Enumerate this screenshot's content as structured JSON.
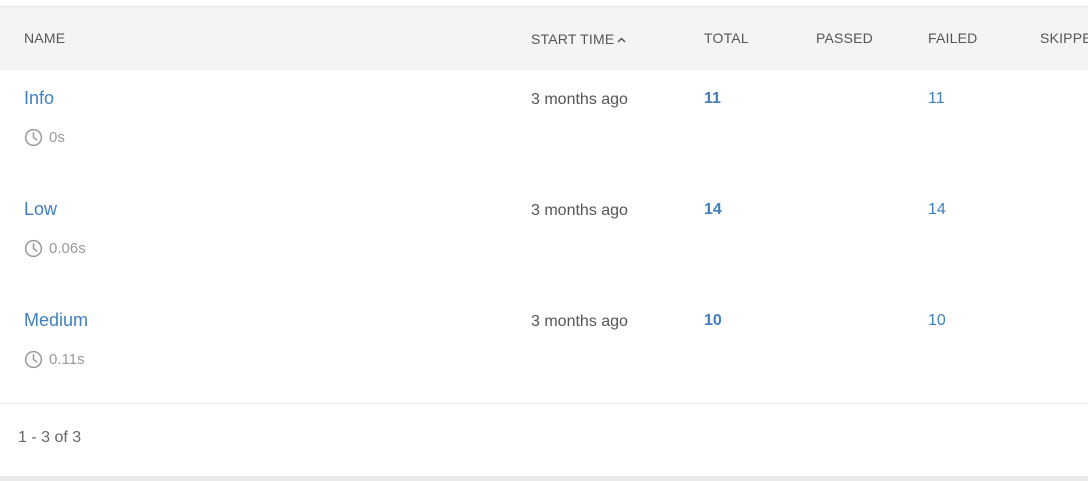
{
  "table": {
    "columns": {
      "name": "NAME",
      "start_time": "START TIME",
      "total": "TOTAL",
      "passed": "PASSED",
      "failed": "FAILED",
      "skipped": "SKIPPED"
    },
    "sort": {
      "column": "start_time",
      "direction": "ascending",
      "icon": "chevron-up-icon"
    },
    "rows": [
      {
        "name": "Info",
        "duration": "0s",
        "start_time": "3 months ago",
        "total": "11",
        "passed": "",
        "failed": "11",
        "duration_icon": "clock-icon"
      },
      {
        "name": "Low",
        "duration": "0.06s",
        "start_time": "3 months ago",
        "total": "14",
        "passed": "",
        "failed": "14",
        "duration_icon": "clock-icon"
      },
      {
        "name": "Medium",
        "duration": "0.11s",
        "start_time": "3 months ago",
        "total": "10",
        "passed": "",
        "failed": "10",
        "duration_icon": "clock-icon"
      }
    ]
  },
  "pagination": {
    "label": "1 - 3 of 3"
  },
  "colors": {
    "link": "#3f7fbf",
    "header_bg": "#f4f4f4",
    "header_text": "#555555",
    "muted_text": "#999999",
    "divider": "#e8e8e8"
  }
}
